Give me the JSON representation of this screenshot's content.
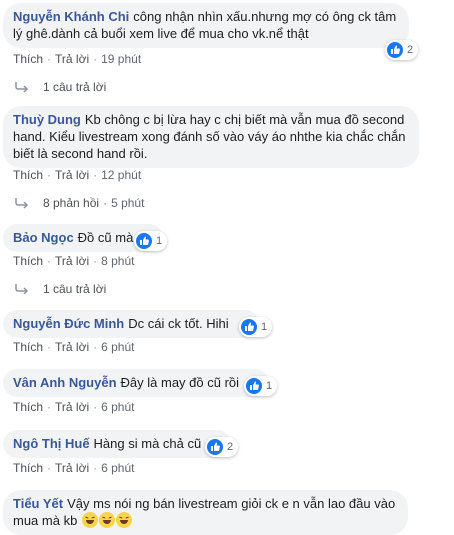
{
  "labels": {
    "like": "Thích",
    "reply": "Trả lời",
    "dot": "·"
  },
  "comments": [
    {
      "author": "Nguyễn Khánh Chi",
      "text": "công nhận nhìn xấu.nhưng mợ có ông ck tâm lý ghê.dành cả buổi xem live để mua cho vk.nể thật",
      "time": "19 phút",
      "reactions": "2",
      "reply_summary": "1 câu trả lời",
      "reply_time": ""
    },
    {
      "author": "Thuỳ Dung",
      "text": "Kb chông c bị lừa hay c chị biết mà vẫn mua đồ second hand. Kiểu livestream xong đánh số vào váy áo nhthe kia chắc chắn biết là second hand rồi.",
      "time": "12 phút",
      "reactions": "",
      "reply_summary": "8 phản hồi",
      "reply_time": "5 phút"
    },
    {
      "author": "Bảo Ngọc",
      "text": "Đồ cũ mà",
      "time": "8 phút",
      "reactions": "1",
      "reply_summary": "1 câu trả lời",
      "reply_time": ""
    },
    {
      "author": "Nguyễn Đức Minh",
      "text": "Dc cái ck tốt. Hihi",
      "time": "6 phút",
      "reactions": "1",
      "reply_summary": "",
      "reply_time": ""
    },
    {
      "author": "Vân Anh Nguyễn",
      "text": "Đây là may đồ cũ rồi",
      "time": "6 phút",
      "reactions": "1",
      "reply_summary": "",
      "reply_time": ""
    },
    {
      "author": "Ngô Thị Huế",
      "text": "Hàng si mà chả cũ",
      "time": "6 phút",
      "reactions": "2",
      "reply_summary": "",
      "reply_time": ""
    },
    {
      "author": "Tiểu Yết",
      "text": "Vậy ms nói ng bán livestream giỏi ck e n vẫn lao đầu vào mua mà kb",
      "time": "",
      "reactions": "",
      "reply_summary": "",
      "reply_time": ""
    }
  ],
  "icons": {
    "like": "like-thumb-icon",
    "haha": "haha-emoji-icon",
    "reply_arrow": "reply-arrow-icon"
  },
  "colors": {
    "author": "#385898",
    "bubble": "#f2f3f5",
    "like_blue": "#1877f2"
  }
}
